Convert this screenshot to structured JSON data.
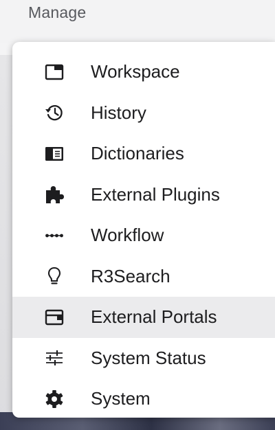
{
  "header": {
    "title": "Manage"
  },
  "menu": {
    "items": [
      {
        "label": "Workspace",
        "icon": "workspace-icon",
        "active": false
      },
      {
        "label": "History",
        "icon": "history-icon",
        "active": false
      },
      {
        "label": "Dictionaries",
        "icon": "dictionary-icon",
        "active": false
      },
      {
        "label": "External Plugins",
        "icon": "puzzle-piece-icon",
        "active": false
      },
      {
        "label": "Workflow",
        "icon": "workflow-icon",
        "active": false
      },
      {
        "label": "R3Search",
        "icon": "lightbulb-icon",
        "active": false
      },
      {
        "label": "External Portals",
        "icon": "portal-window-icon",
        "active": true
      },
      {
        "label": "System Status",
        "icon": "sliders-icon",
        "active": false
      },
      {
        "label": "System",
        "icon": "gear-icon",
        "active": false
      }
    ]
  },
  "colors": {
    "active_bg": "#ebebed",
    "icon": "#1d1d1f",
    "text": "#1d1d1f"
  }
}
